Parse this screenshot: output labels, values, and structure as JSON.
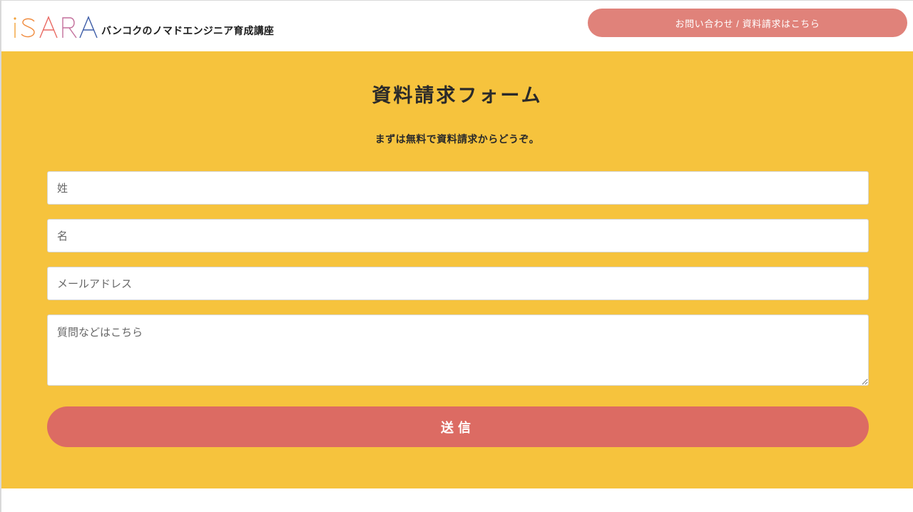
{
  "header": {
    "logo_text": "iSARA",
    "tagline": "バンコクのノマドエンジニア育成講座",
    "contact_button": "お問い合わせ / 資料請求はこちら"
  },
  "form": {
    "title": "資料請求フォーム",
    "subtitle": "まずは無料で資料請求からどうぞ。",
    "last_name_placeholder": "姓",
    "first_name_placeholder": "名",
    "email_placeholder": "メールアドレス",
    "question_placeholder": "質問などはこちら",
    "submit_label": "送信"
  },
  "colors": {
    "background_accent": "#f6c33d",
    "button": "#dc6b63",
    "header_button": "#e0827a"
  }
}
